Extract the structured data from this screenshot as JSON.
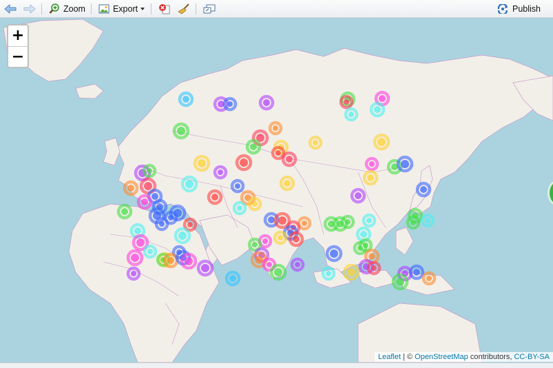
{
  "toolbar": {
    "back_icon": "arrow-left-icon",
    "forward_icon": "arrow-right-icon",
    "zoom_label": "Zoom",
    "export_label": "Export",
    "publish_label": "Publish",
    "colors": {
      "accent": "#2a6db7"
    }
  },
  "map": {
    "zoom_in_label": "+",
    "zoom_out_label": "−",
    "attribution": {
      "leaflet": "Leaflet",
      "separator": " | © ",
      "osm": "OpenStreetMap",
      "contributors": " contributors, ",
      "license": "CC-BY-SA"
    },
    "colors": {
      "water": "#aad3df",
      "land": "#f2efe9",
      "border": "#c59bc9"
    },
    "marker_colors": [
      "#ff3b5c",
      "#33c4ff",
      "#44e044",
      "#ffd12e",
      "#b040ff",
      "#ff8a2e",
      "#3a66ff",
      "#ff3ee0",
      "#4df0f0",
      "#ff4040"
    ]
  }
}
